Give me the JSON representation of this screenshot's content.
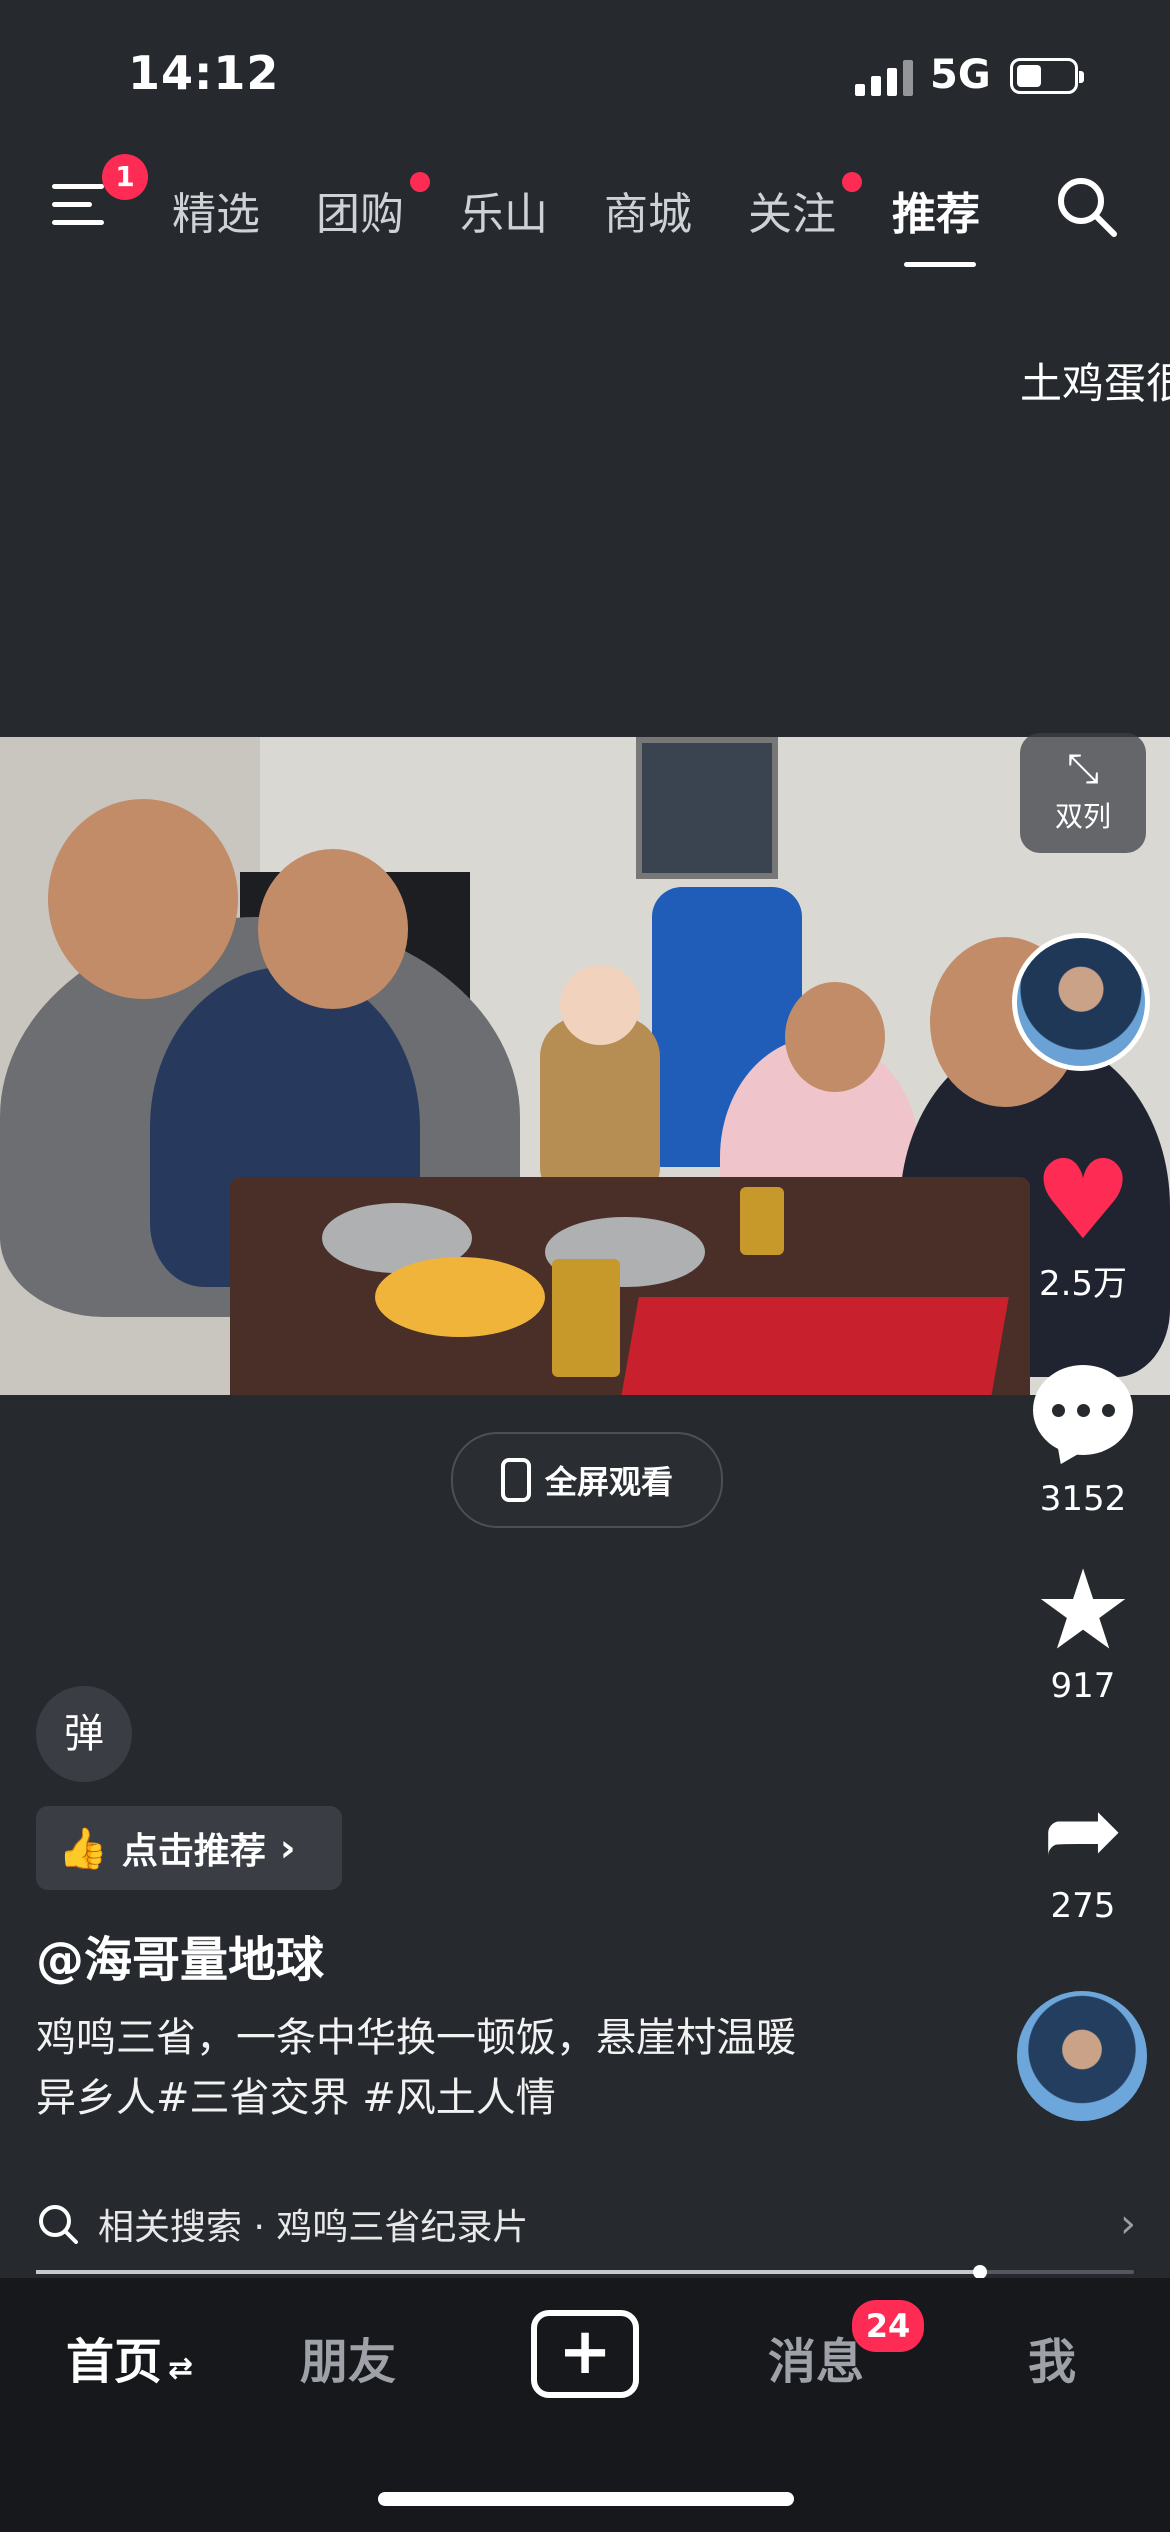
{
  "status_bar": {
    "time": "14:12",
    "network": "5G"
  },
  "top_nav": {
    "menu_badge": "1",
    "tabs": [
      {
        "label": "精选",
        "dot": false,
        "active": false
      },
      {
        "label": "团购",
        "dot": true,
        "active": false
      },
      {
        "label": "乐山",
        "dot": false,
        "active": false
      },
      {
        "label": "商城",
        "dot": false,
        "active": false
      },
      {
        "label": "关注",
        "dot": true,
        "active": false
      },
      {
        "label": "推荐",
        "dot": false,
        "active": true
      }
    ]
  },
  "floating_text": "土鸡蛋很",
  "video": {
    "double_col_label": "双列",
    "fullscreen_label": "全屏观看"
  },
  "right_rail": {
    "likes": "2.5万",
    "comments": "3152",
    "favorites": "917",
    "shares": "275"
  },
  "content": {
    "danmaku_label": "弹",
    "recommend_label": "点击推荐",
    "author": "@海哥量地球",
    "caption_line1": "鸡鸣三省，一条中华换一顿饭，悬崖村温暖",
    "caption_line2": "异乡人#三省交界 #风土人情",
    "related_search": "相关搜索 · 鸡鸣三省纪录片",
    "progress_percent": 86
  },
  "bottom_bar": {
    "home": "首页",
    "home_suffix": "⇄",
    "friends": "朋友",
    "messages": "消息",
    "messages_badge": "24",
    "me": "我"
  },
  "colors": {
    "accent": "#fe2c55",
    "background": "#262a2f"
  }
}
